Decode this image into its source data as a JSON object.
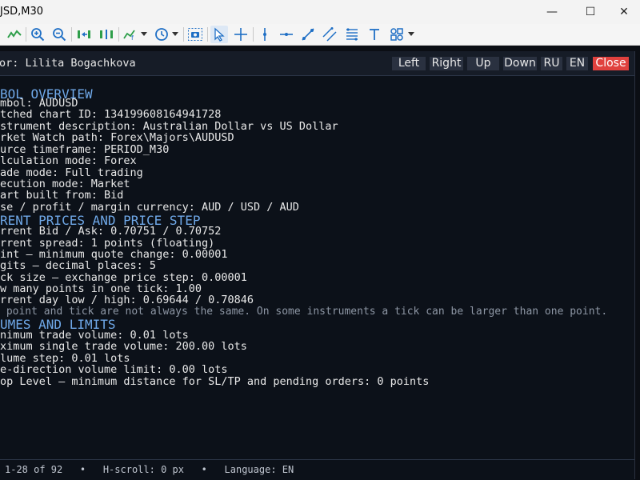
{
  "window": {
    "title": "JSD,M30",
    "minimize": "—",
    "maximize": "☐",
    "close": "✕"
  },
  "toolbar": {
    "icons": [
      "line-chart-icon",
      "zoom-in-icon",
      "zoom-out-icon",
      "auto-scroll-icon",
      "chart-shift-icon",
      "indicators-icon",
      "dropdown-icon",
      "periods-clock-icon",
      "dropdown-icon",
      "screenshot-icon",
      "cursor-icon",
      "crosshair-icon",
      "vertical-line-icon",
      "horizontal-line-icon",
      "trendline-icon",
      "channel-icon",
      "fibonacci-icon",
      "text-icon",
      "shapes-icon",
      "dropdown-icon"
    ]
  },
  "panel": {
    "author": "or: Lilita Bogachkova",
    "buttons": {
      "left": "Left",
      "right": "Right",
      "up": "Up",
      "down": "Down",
      "ru": "RU",
      "en": "EN",
      "close": "Close"
    },
    "lines": [
      {
        "text": "BOL OVERVIEW",
        "kind": "heading"
      },
      {
        "text": "mbol: AUDUSD",
        "kind": "text"
      },
      {
        "text": "tched chart ID: 134199608164941728",
        "kind": "text"
      },
      {
        "text": "strument description: Australian Dollar vs US Dollar",
        "kind": "text"
      },
      {
        "text": "rket Watch path: Forex\\Majors\\AUDUSD",
        "kind": "text"
      },
      {
        "text": "urce timeframe: PERIOD_M30",
        "kind": "text"
      },
      {
        "text": "lculation mode: Forex",
        "kind": "text"
      },
      {
        "text": "ade mode: Full trading",
        "kind": "text"
      },
      {
        "text": "ecution mode: Market",
        "kind": "text"
      },
      {
        "text": "art built from: Bid",
        "kind": "text"
      },
      {
        "text": "se / profit / margin currency: AUD / USD / AUD",
        "kind": "text"
      },
      {
        "text": "RENT PRICES AND PRICE STEP",
        "kind": "heading"
      },
      {
        "text": "rrent Bid / Ask: 0.70751 / 0.70752",
        "kind": "text"
      },
      {
        "text": "rrent spread: 1 points (floating)",
        "kind": "text"
      },
      {
        "text": "int — minimum quote change: 0.00001",
        "kind": "text"
      },
      {
        "text": "gits — decimal places: 5",
        "kind": "text"
      },
      {
        "text": "ck size — exchange price step: 0.00001",
        "kind": "text"
      },
      {
        "text": "w many points in one tick: 1.00",
        "kind": "text"
      },
      {
        "text": "rrent day low / high: 0.69644 / 0.70846",
        "kind": "text"
      },
      {
        "text": " point and tick are not always the same. On some instruments a tick can be larger than one point.",
        "kind": "note"
      },
      {
        "text": "UMES AND LIMITS",
        "kind": "heading"
      },
      {
        "text": "nimum trade volume: 0.01 lots",
        "kind": "text"
      },
      {
        "text": "ximum single trade volume: 200.00 lots",
        "kind": "text"
      },
      {
        "text": "lume step: 0.01 lots",
        "kind": "text"
      },
      {
        "text": "e-direction volume limit: 0.00 lots",
        "kind": "text"
      },
      {
        "text": "op Level — minimum distance for SL/TP and pending orders: 0 points",
        "kind": "text"
      }
    ],
    "status": "1-28 of 92   •   H-scroll: 0 px   •   Language: EN"
  },
  "colors": {
    "heading": "#6fa8e8",
    "text": "#e9e9e9",
    "note": "#8d96a4",
    "close_button": "#e0413e",
    "panel_bg": "#0c1119"
  }
}
